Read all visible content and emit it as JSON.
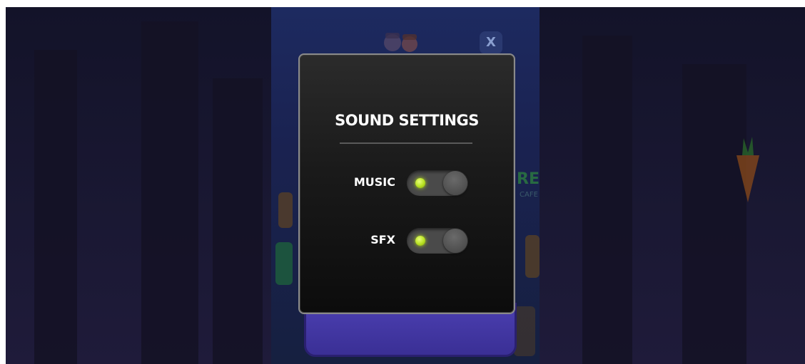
{
  "dialog": {
    "title": "SOUND SETTINGS",
    "settings": [
      {
        "label": "MUSIC",
        "enabled": true
      },
      {
        "label": "SFX",
        "enabled": true
      }
    ]
  },
  "background": {
    "close_label": "X",
    "cafe_label": "CAFE"
  },
  "colors": {
    "dialog_bg": "#1a1a1a",
    "dialog_border": "#8a8a8a",
    "toggle_led": "#b6e020",
    "toggle_track": "#4a4a4a",
    "popup_purple": "#4b3fb0"
  },
  "icons": {
    "close": "close-icon",
    "toggle_on": "toggle-on-led-icon"
  }
}
